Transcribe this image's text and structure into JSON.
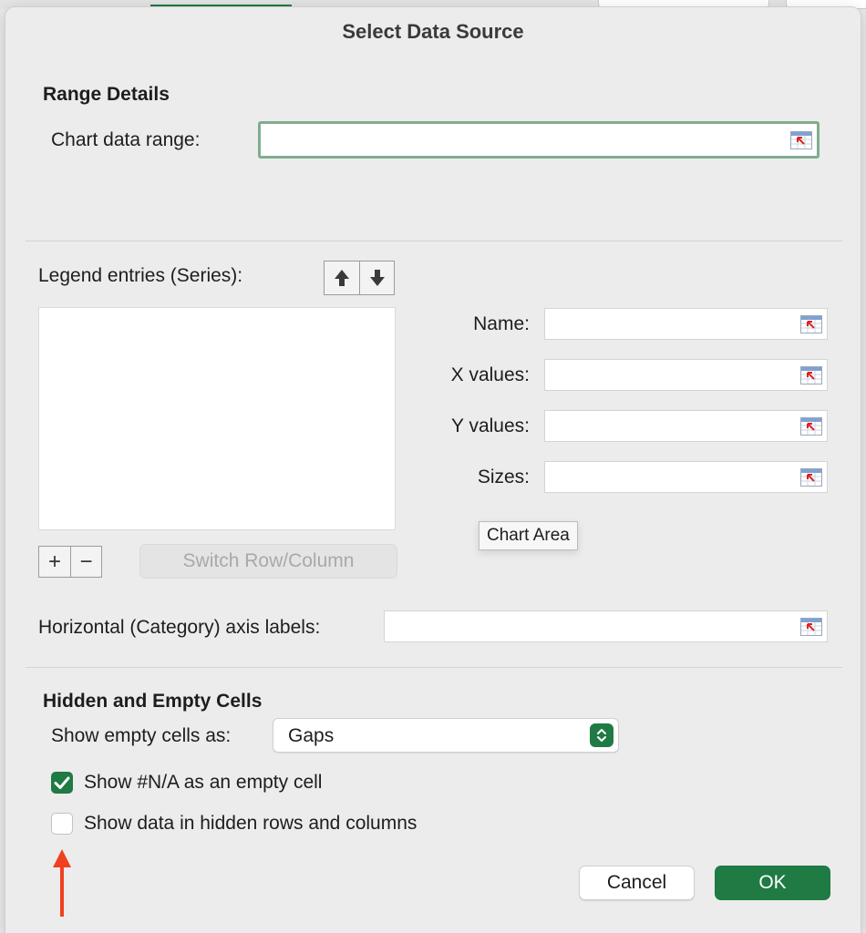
{
  "dialog": {
    "title": "Select Data Source"
  },
  "range_details": {
    "heading": "Range Details",
    "chart_data_range_label": "Chart data range:",
    "chart_data_range_value": ""
  },
  "series": {
    "legend_label": "Legend entries (Series):",
    "items": [],
    "add_symbol": "+",
    "remove_symbol": "−",
    "switch_label": "Switch Row/Column",
    "name_label": "Name:",
    "x_values_label": "X values:",
    "y_values_label": "Y values:",
    "sizes_label": "Sizes:"
  },
  "tooltip": {
    "text": "Chart Area"
  },
  "axis": {
    "label": "Horizontal (Category) axis labels:",
    "value": ""
  },
  "hidden_empty": {
    "heading": "Hidden and Empty Cells",
    "show_empty_label": "Show empty cells as:",
    "show_empty_value": "Gaps",
    "show_na_label": "Show #N/A as an empty cell",
    "show_na_checked": true,
    "show_hidden_label": "Show data in hidden rows and columns",
    "show_hidden_checked": false
  },
  "buttons": {
    "cancel": "Cancel",
    "ok": "OK"
  },
  "colors": {
    "accent": "#1f7a44",
    "annotation_arrow": "#f0401f",
    "focus_ring": "#7fad8e"
  },
  "icons": [
    "range-picker-icon",
    "arrow-up-icon",
    "arrow-down-icon",
    "stepper-icon",
    "checkmark-icon"
  ]
}
